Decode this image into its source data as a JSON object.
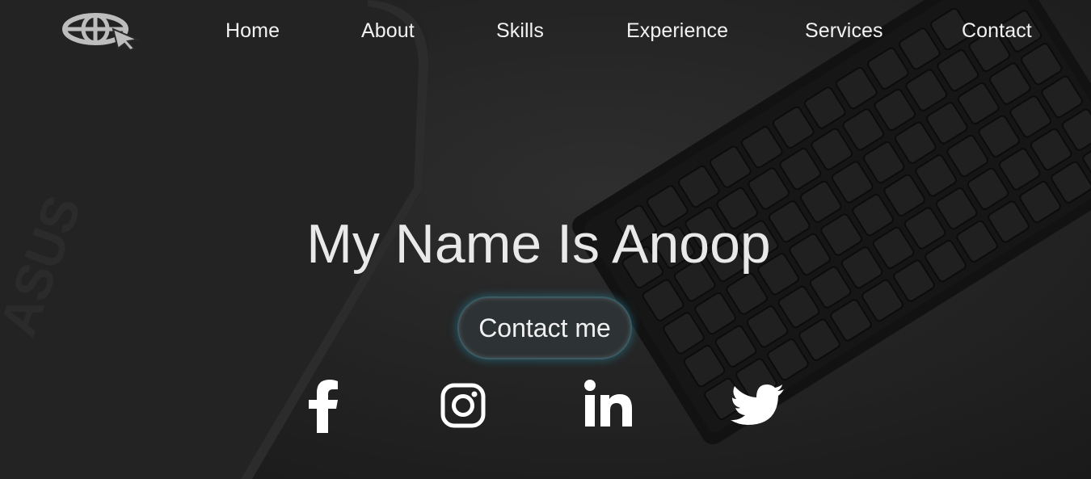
{
  "nav": {
    "logo_icon": "globe-cursor-logo",
    "links": [
      "Home",
      "About",
      "Skills",
      "Experience",
      "Services",
      "Contact"
    ]
  },
  "hero": {
    "headline": "My Name Is Anoop",
    "cta_label": "Contact me"
  },
  "social": {
    "icons": [
      "facebook-icon",
      "instagram-icon",
      "linkedin-icon",
      "twitter-icon"
    ]
  },
  "background": {
    "description_icons": [
      "laptop-image",
      "keyboard-image"
    ],
    "laptop_brand_text": "ASUS"
  },
  "colors": {
    "text": "#f2f2f2",
    "button_glow": "#2a7c8c",
    "background": "#222222"
  }
}
